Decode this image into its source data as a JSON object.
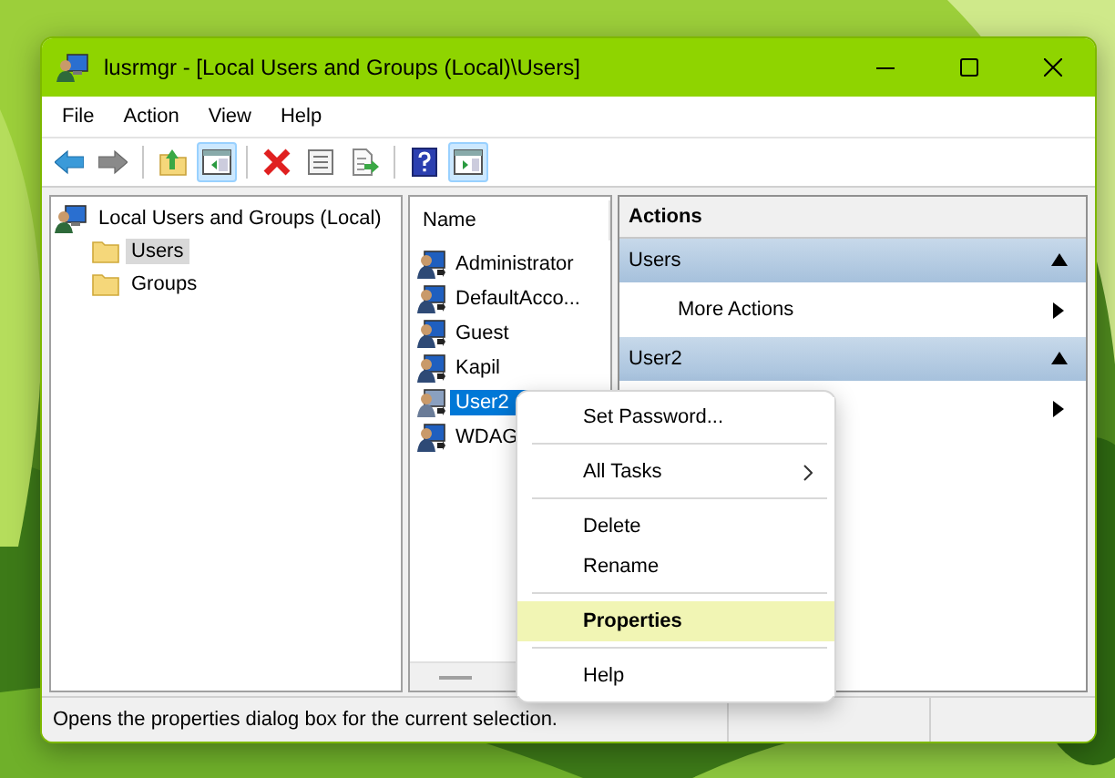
{
  "window": {
    "title": "lusrmgr - [Local Users and Groups (Local)\\Users]"
  },
  "menu": [
    "File",
    "Action",
    "View",
    "Help"
  ],
  "toolbar": [
    {
      "kind": "back",
      "pressed": false
    },
    {
      "kind": "forward",
      "pressed": false
    },
    {
      "kind": "separator"
    },
    {
      "kind": "up",
      "pressed": false
    },
    {
      "kind": "tree",
      "pressed": true
    },
    {
      "kind": "separator"
    },
    {
      "kind": "delete",
      "pressed": false
    },
    {
      "kind": "properties",
      "pressed": false
    },
    {
      "kind": "export",
      "pressed": false
    },
    {
      "kind": "separator"
    },
    {
      "kind": "help",
      "pressed": false
    },
    {
      "kind": "actionpane",
      "pressed": true
    }
  ],
  "tree": [
    {
      "label": "Local Users and Groups (Local)",
      "selected": false,
      "children": [
        {
          "label": "Users",
          "selected": true
        },
        {
          "label": "Groups",
          "selected": false
        }
      ]
    }
  ],
  "list": {
    "columns": [
      "Name"
    ],
    "rows": [
      {
        "name": "Administrator",
        "selected": false
      },
      {
        "name": "DefaultAcco...",
        "selected": false
      },
      {
        "name": "Guest",
        "selected": false
      },
      {
        "name": "Kapil",
        "selected": false
      },
      {
        "name": "User2",
        "selected": true
      },
      {
        "name": "WDAG",
        "selected": false
      }
    ]
  },
  "actions": {
    "title": "Actions",
    "sections": [
      {
        "label": "Users",
        "expanded": true,
        "items": [
          {
            "kind": "submenu",
            "label": "More Actions"
          }
        ]
      },
      {
        "label": "User2",
        "expanded": true,
        "items": [
          {
            "kind": "submenu"
          }
        ]
      }
    ]
  },
  "context_menu": [
    {
      "kind": "item",
      "label": "Set Password...",
      "selected": false
    },
    {
      "kind": "separator"
    },
    {
      "kind": "submenu",
      "label": "All Tasks",
      "selected": false
    },
    {
      "kind": "separator"
    },
    {
      "kind": "item",
      "label": "Delete",
      "selected": false
    },
    {
      "kind": "item",
      "label": "Rename",
      "selected": false
    },
    {
      "kind": "separator"
    },
    {
      "kind": "item",
      "label": "Properties",
      "selected": true
    },
    {
      "kind": "separator"
    },
    {
      "kind": "item",
      "label": "Help",
      "selected": false
    }
  ],
  "status_bar": {
    "text": "Opens the properties dialog box for the current selection."
  }
}
